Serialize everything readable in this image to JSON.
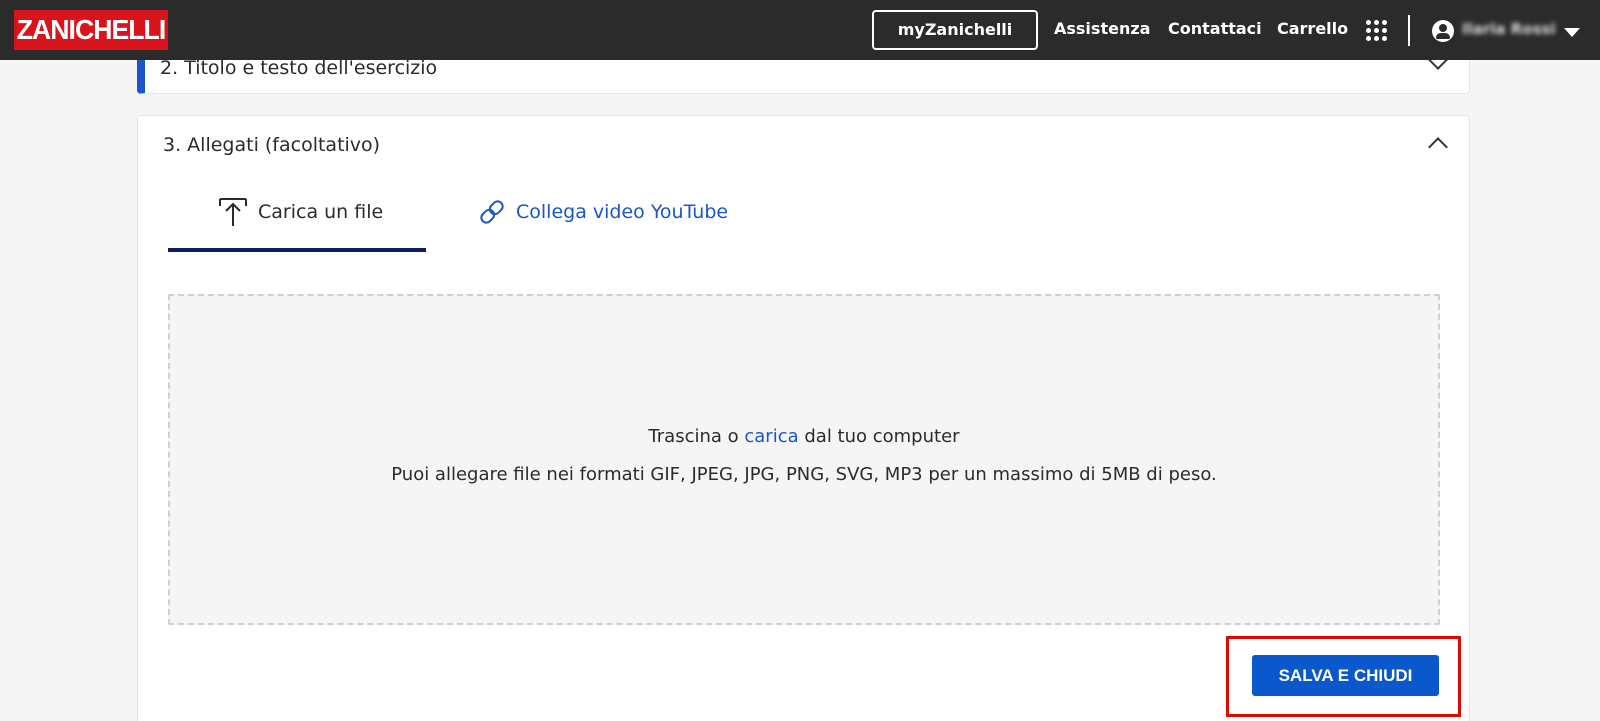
{
  "header": {
    "logo_text": "ZANICHELLI",
    "myzanichelli_label": "myZanichelli",
    "nav": [
      "Assistenza",
      "Contattaci",
      "Carrello"
    ],
    "user_name": "Ilaria Rossi"
  },
  "section2": {
    "title": "2. Titolo e testo dell'esercizio",
    "icon": "chevron-down-icon"
  },
  "section3": {
    "title": "3. Allegati (facoltativo)",
    "icon": "chevron-up-icon",
    "tabs": [
      {
        "label": "Carica un file",
        "icon": "upload-icon",
        "active": true
      },
      {
        "label": "Collega video YouTube",
        "icon": "link-icon",
        "active": false
      }
    ],
    "dropzone": {
      "text_before": "Trascina o ",
      "link_text": "carica",
      "text_after": " dal tuo computer",
      "formats_note": "Puoi allegare file nei formati GIF, JPEG, JPG, PNG, SVG, MP3 per un massimo di 5MB di peso."
    },
    "save_button": "SALVA E CHIUDI"
  },
  "colors": {
    "brand_red": "#d8151c",
    "header_bg": "#2b2b2b",
    "accent_blue": "#1a56c8",
    "tab_underline": "#0f1e5a",
    "button_blue": "#0b57cc",
    "highlight_red": "#e10600"
  }
}
